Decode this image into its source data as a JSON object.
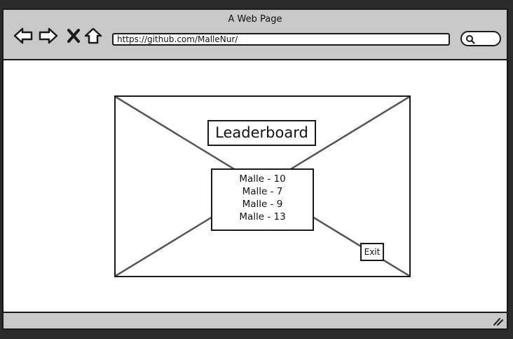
{
  "window": {
    "title": "A Web Page"
  },
  "browser": {
    "url": "https://github.com/MalleNur/",
    "icons": [
      "back-arrow-icon",
      "forward-arrow-icon",
      "close-x-icon",
      "home-icon",
      "search-icon",
      "resize-grip-icon"
    ]
  },
  "leaderboard": {
    "title": "Leaderboard",
    "scores": [
      "Malle - 10",
      "Malle - 7",
      "Malle - 9",
      "Malle - 13"
    ],
    "exit_label": "Exit"
  }
}
